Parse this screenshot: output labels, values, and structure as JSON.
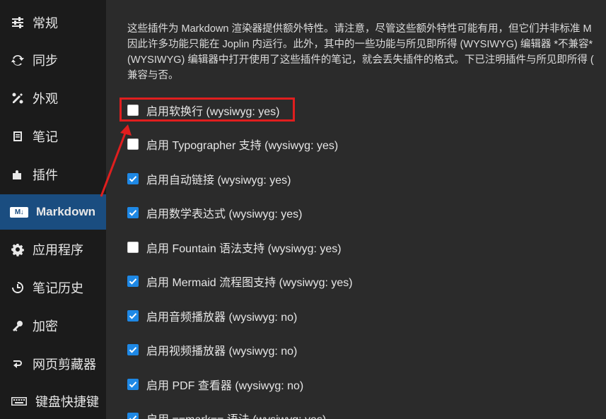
{
  "sidebar": {
    "items": [
      {
        "label": "常规",
        "icon": "sliders-icon",
        "active": false
      },
      {
        "label": "同步",
        "icon": "sync-icon",
        "active": false
      },
      {
        "label": "外观",
        "icon": "appearance-icon",
        "active": false
      },
      {
        "label": "笔记",
        "icon": "note-icon",
        "active": false
      },
      {
        "label": "插件",
        "icon": "puzzle-icon",
        "active": false
      },
      {
        "label": "Markdown",
        "icon": "markdown-icon",
        "badge": "M↓",
        "active": true
      },
      {
        "label": "应用程序",
        "icon": "gear-icon",
        "active": false
      },
      {
        "label": "笔记历史",
        "icon": "history-icon",
        "active": false
      },
      {
        "label": "加密",
        "icon": "key-icon",
        "active": false
      },
      {
        "label": "网页剪藏器",
        "icon": "clipper-icon",
        "active": false
      },
      {
        "label": "键盘快捷键",
        "icon": "keyboard-icon",
        "active": false
      }
    ]
  },
  "description": {
    "lines": [
      "这些插件为 Markdown 渲染器提供额外特性。请注意，尽管这些额外特性可能有用，但它们并非标准 M",
      "因此许多功能只能在 Joplin 内运行。此外，其中的一些功能与所见即所得 (WYSIWYG) 编辑器 *不兼容*",
      "(WYSIWYG) 编辑器中打开使用了这些插件的笔记，就会丢失插件的格式。下已注明插件与所见即所得 (",
      "兼容与否。"
    ]
  },
  "options": [
    {
      "label": "启用软换行 (wysiwyg: yes)",
      "checked": false
    },
    {
      "label": "启用 Typographer 支持 (wysiwyg: yes)",
      "checked": false
    },
    {
      "label": "启用自动链接 (wysiwyg: yes)",
      "checked": true
    },
    {
      "label": "启用数学表达式 (wysiwyg: yes)",
      "checked": true
    },
    {
      "label": "启用 Fountain 语法支持 (wysiwyg: yes)",
      "checked": false
    },
    {
      "label": "启用 Mermaid 流程图支持 (wysiwyg: yes)",
      "checked": true
    },
    {
      "label": "启用音频播放器 (wysiwyg: no)",
      "checked": true
    },
    {
      "label": "启用视频播放器 (wysiwyg: no)",
      "checked": true
    },
    {
      "label": "启用 PDF 查看器 (wysiwyg: no)",
      "checked": true
    },
    {
      "label": "启用 ==mark== 语法 (wysiwyg: yes)",
      "checked": true
    }
  ],
  "colors": {
    "accent": "#1e88e5",
    "sidebar_active": "#1a4d80",
    "annotation": "#e01e1e"
  }
}
